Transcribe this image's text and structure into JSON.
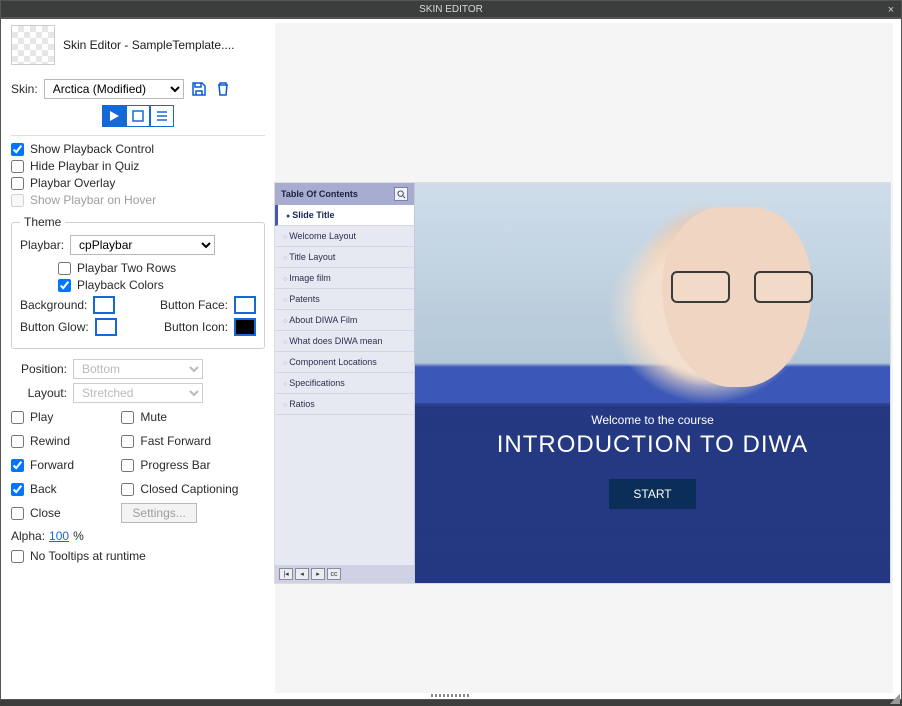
{
  "window": {
    "title": "SKIN EDITOR"
  },
  "identity": {
    "label": "Skin Editor - SampleTemplate...."
  },
  "skin_select": {
    "label": "Skin:",
    "value": "Arctica (Modified)"
  },
  "checks": {
    "show_playback": {
      "label": "Show Playback Control",
      "checked": true
    },
    "hide_playbar_quiz": {
      "label": "Hide Playbar in Quiz",
      "checked": false
    },
    "playbar_overlay": {
      "label": "Playbar Overlay",
      "checked": false
    },
    "show_playbar_hover": {
      "label": "Show Playbar on Hover",
      "checked": false
    }
  },
  "theme": {
    "legend": "Theme",
    "playbar_label": "Playbar:",
    "playbar_value": "cpPlaybar",
    "two_rows": {
      "label": "Playbar Two Rows",
      "checked": false
    },
    "playback_colors": {
      "label": "Playback Colors",
      "checked": true
    },
    "swatches": {
      "background_label": "Background:",
      "button_face_label": "Button Face:",
      "button_glow_label": "Button Glow:",
      "button_icon_label": "Button Icon:"
    }
  },
  "position": {
    "label": "Position:",
    "value": "Bottom"
  },
  "layout": {
    "label": "Layout:",
    "value": "Stretched"
  },
  "options": {
    "play": {
      "label": "Play",
      "checked": false
    },
    "mute": {
      "label": "Mute",
      "checked": false
    },
    "rewind": {
      "label": "Rewind",
      "checked": false
    },
    "ff": {
      "label": "Fast Forward",
      "checked": false
    },
    "forward": {
      "label": "Forward",
      "checked": true
    },
    "progress": {
      "label": "Progress Bar",
      "checked": false
    },
    "back": {
      "label": "Back",
      "checked": true
    },
    "cc": {
      "label": "Closed Captioning",
      "checked": false
    },
    "close": {
      "label": "Close",
      "checked": false
    },
    "settings_label": "Settings..."
  },
  "alpha": {
    "label": "Alpha:",
    "value": "100",
    "suffix": "%"
  },
  "no_tooltips": {
    "label": "No Tooltips at runtime",
    "checked": false
  },
  "preview": {
    "toc_header": "Table Of Contents",
    "items": [
      "Slide Title",
      "Welcome Layout",
      "Title Layout",
      "Image film",
      "Patents",
      "About DIWA Film",
      "What does DIWA mean",
      "Component Locations",
      "Specifications",
      "Ratios"
    ],
    "subtitle": "Welcome to the course",
    "hero": "INTRODUCTION TO DIWA",
    "start": "START"
  }
}
